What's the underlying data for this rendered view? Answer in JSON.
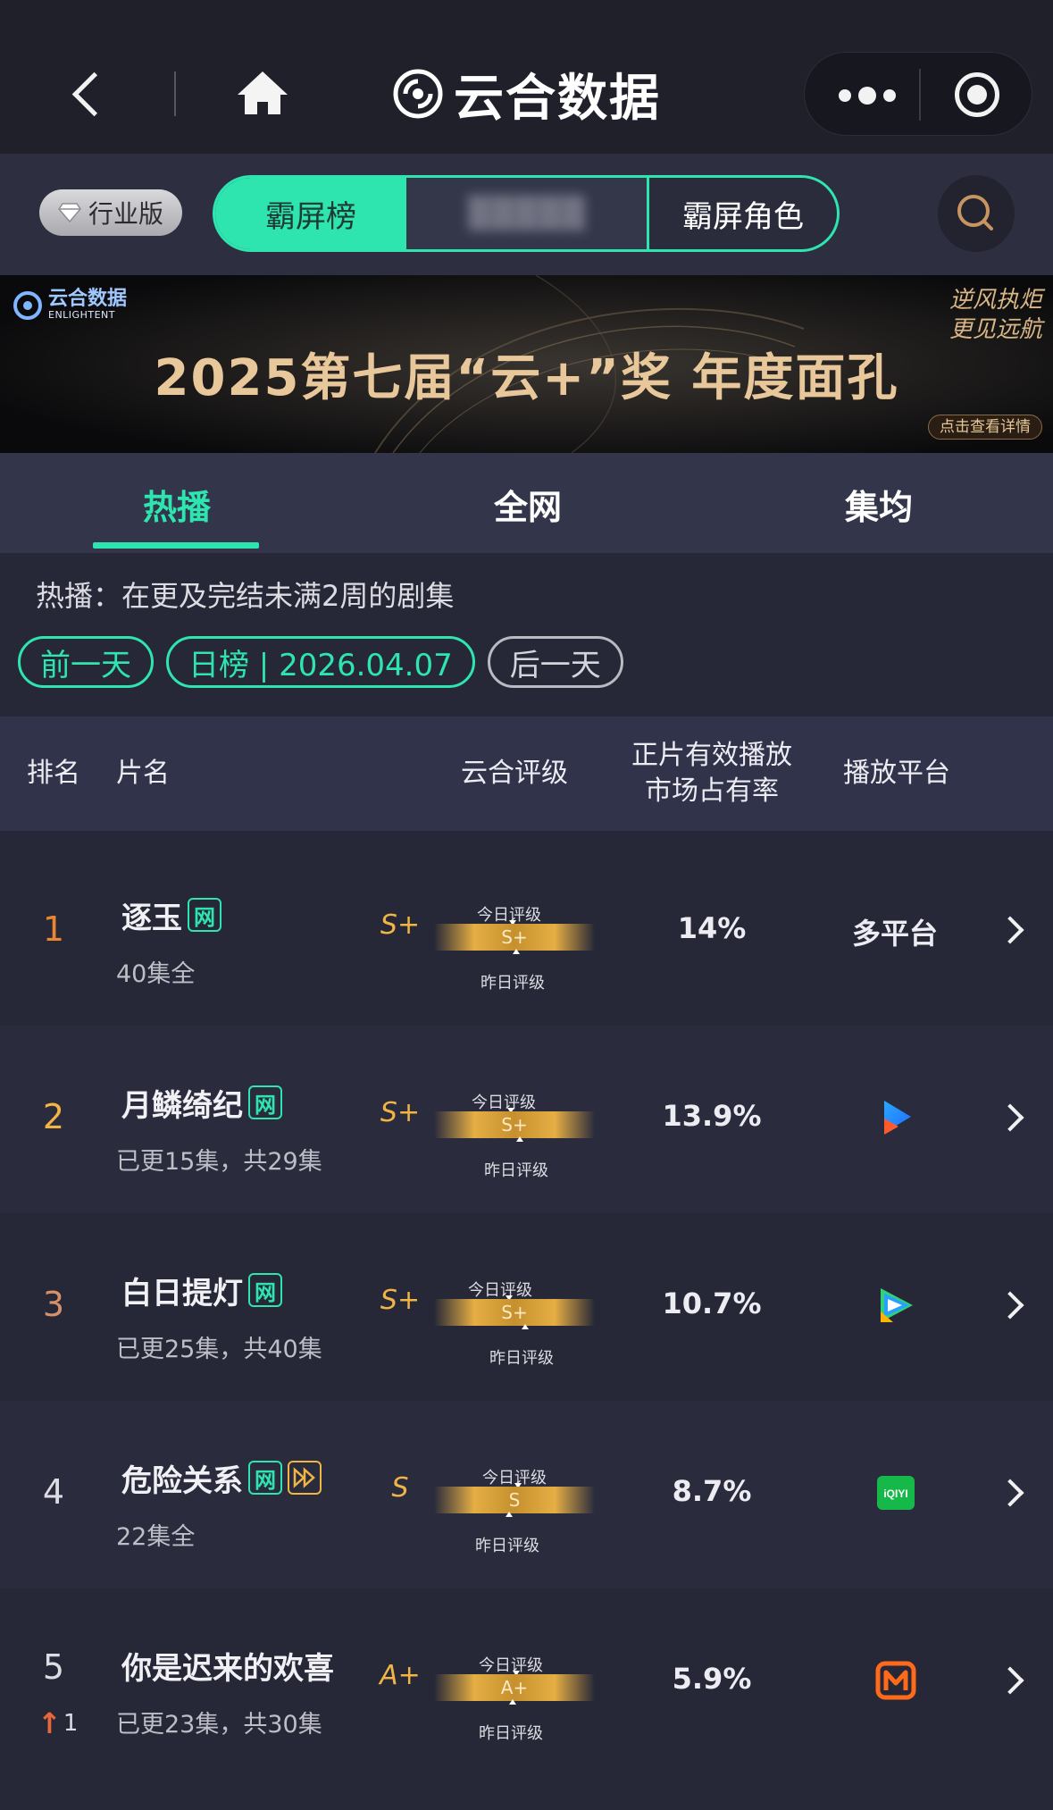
{
  "nav": {
    "app_title": "云合数据"
  },
  "filter": {
    "industry_badge": "行业版",
    "seg_tabs": [
      {
        "label": "霸屏榜",
        "active": true
      },
      {
        "label": "",
        "blurred": true
      },
      {
        "label": "霸屏角色",
        "active": false
      }
    ]
  },
  "banner": {
    "logo_text": "云合数据",
    "logo_sub": "ENLIGHTENT",
    "title": "2025第七届“云+”奖  年度面孔",
    "slogan_line1": "逆风执炬",
    "slogan_line2": "更见远航",
    "detail_button": "点击查看详情"
  },
  "main_tabs": [
    {
      "label": "热播",
      "active": true
    },
    {
      "label": "全网",
      "active": false
    },
    {
      "label": "集均",
      "active": false
    }
  ],
  "hint": "热播：在更及完结未满2周的剧集",
  "date_nav": {
    "prev": "前一天",
    "current": "日榜 | 2026.04.07",
    "next": "后一天"
  },
  "table": {
    "headers": {
      "rank": "排名",
      "title": "片名",
      "grade": "云合评级",
      "share_line1": "正片有效播放",
      "share_line2": "市场占有率",
      "platform": "播放平台"
    },
    "grade_today_label": "今日评级",
    "grade_yesterday_label": "昨日评级",
    "rows": [
      {
        "rank": "1",
        "title": "逐玉",
        "tag": "网",
        "episodes": "40集全",
        "grade": "S+",
        "grade_bar": "S+",
        "share": "14%",
        "platform": "多平台",
        "platform_icon": "",
        "rank_color": "#e8872f"
      },
      {
        "rank": "2",
        "title": "月鳞绮纪",
        "tag": "网",
        "episodes": "已更15集，共29集",
        "grade": "S+",
        "grade_bar": "S+",
        "share": "13.9%",
        "platform": "",
        "platform_icon": "youku-icon",
        "rank_color": "#f0b544"
      },
      {
        "rank": "3",
        "title": "白日提灯",
        "tag": "网",
        "episodes": "已更25集，共40集",
        "grade": "S+",
        "grade_bar": "S+",
        "share": "10.7%",
        "platform": "",
        "platform_icon": "tencent-video-icon",
        "rank_color": "#d7916a"
      },
      {
        "rank": "4",
        "title": "危险关系",
        "tag": "网",
        "episodes": "22集全",
        "grade": "S",
        "grade_bar": "S",
        "share": "8.7%",
        "platform": "",
        "platform_icon": "iqiyi-icon",
        "rank_color": "#dcdce2"
      },
      {
        "rank": "5",
        "rank_change": "1",
        "title": "你是迟来的欢喜",
        "tag": "",
        "episodes": "已更23集，共30集",
        "grade": "A+",
        "grade_bar": "A+",
        "share": "5.9%",
        "platform": "",
        "platform_icon": "mango-tv-icon",
        "rank_color": "#dcdce2"
      }
    ]
  },
  "iqiyi_logo_text": "iQIYI",
  "colors": {
    "accent": "#2ee5b0",
    "gold": "#f0b544",
    "background": "#262837"
  }
}
